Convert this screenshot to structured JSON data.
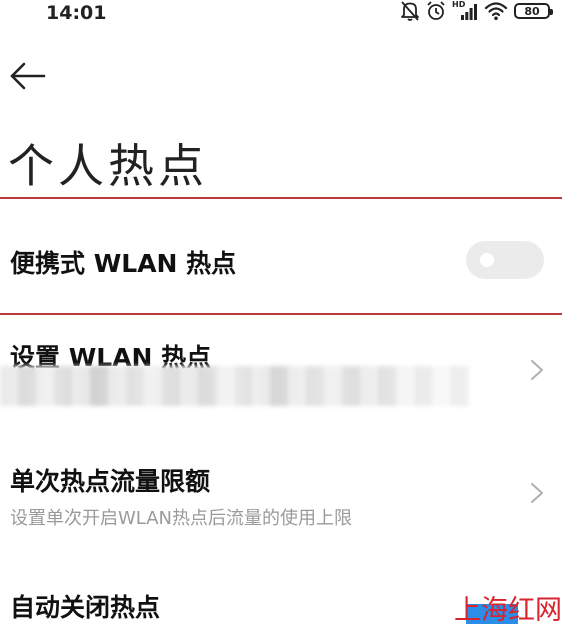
{
  "status_bar": {
    "time": "14:01",
    "icons": [
      "bell-muted-icon",
      "alarm-icon",
      "hd-signal-icon",
      "wifi-icon",
      "battery-icon"
    ],
    "network_badge": "HD",
    "battery_level": "80"
  },
  "header": {
    "back_icon": "arrow-left-icon",
    "title": "个人热点"
  },
  "settings": {
    "portable_hotspot": {
      "title": "便携式 WLAN 热点",
      "enabled": false
    },
    "setup_hotspot": {
      "title": "设置 WLAN 热点"
    },
    "data_limit": {
      "title": "单次热点流量限额",
      "subtitle": "设置单次开启WLAN热点后流量的使用上限"
    },
    "auto_off": {
      "title": "自动关闭热点"
    }
  },
  "watermark": {
    "text": "上海红网"
  },
  "colors": {
    "highlight_line": "#b93a3a",
    "watermark": "#d9232f",
    "toggle_off": "#ebebeb",
    "subtitle": "#9a9a9a"
  }
}
